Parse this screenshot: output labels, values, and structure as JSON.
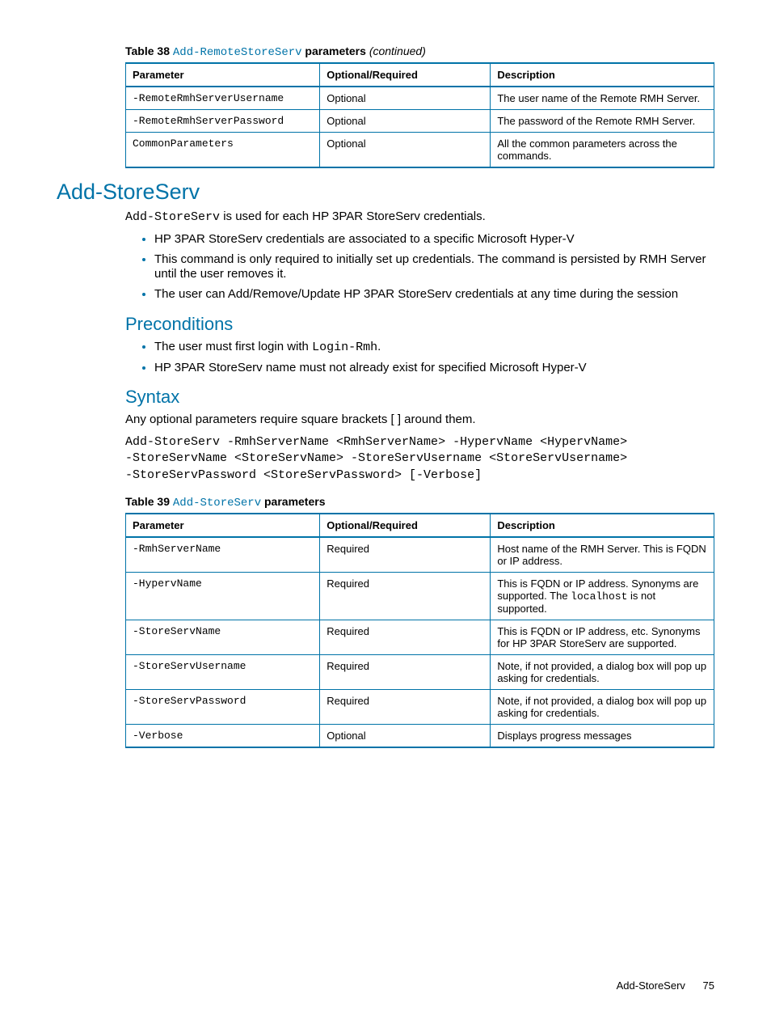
{
  "table38": {
    "caption_prefix": "Table 38 ",
    "caption_code": "Add-RemoteStoreServ",
    "caption_suffix": " parameters ",
    "caption_cont": "(continued)",
    "headers": {
      "param": "Parameter",
      "opt": "Optional/Required",
      "desc": "Description"
    },
    "rows": [
      {
        "param": "-RemoteRmhServerUsername",
        "opt": "Optional",
        "desc": "The user name of the Remote RMH Server."
      },
      {
        "param": "-RemoteRmhServerPassword",
        "opt": "Optional",
        "desc": "The password of the Remote RMH Server."
      },
      {
        "param": "CommonParameters",
        "opt": "Optional",
        "desc": "All the common parameters across the commands."
      }
    ]
  },
  "section": {
    "h1": "Add-StoreServ",
    "intro_code": "Add-StoreServ",
    "intro_rest": " is used for each HP 3PAR StoreServ credentials.",
    "bullets": [
      "HP 3PAR StoreServ credentials are associated to a specific Microsoft Hyper-V",
      "This command is only required to initially set up credentials. The command is persisted by RMH Server until the user removes it.",
      "The user can Add/Remove/Update HP 3PAR StoreServ credentials at any time during the session"
    ]
  },
  "preconditions": {
    "h2": "Preconditions",
    "b1_pre": "The user must first login with ",
    "b1_code": "Login-Rmh",
    "b1_post": ".",
    "b2": "HP 3PAR StoreServ name must not already exist for specified Microsoft Hyper-V"
  },
  "syntax": {
    "h2": "Syntax",
    "note": "Any optional parameters require square brackets [ ] around them.",
    "code": "Add-StoreServ -RmhServerName <RmhServerName> -HypervName <HypervName>\n-StoreServName <StoreServName> -StoreServUsername <StoreServUsername>\n-StoreServPassword <StoreServPassword> [-Verbose]"
  },
  "table39": {
    "caption_prefix": "Table 39 ",
    "caption_code": "Add-StoreServ",
    "caption_suffix": " parameters",
    "headers": {
      "param": "Parameter",
      "opt": "Optional/Required",
      "desc": "Description"
    },
    "rows": [
      {
        "param": "-RmhServerName",
        "opt": "Required",
        "desc_pre": "Host name of the RMH Server. This is FQDN or IP address.",
        "desc_code": "",
        "desc_post": ""
      },
      {
        "param": "-HypervName",
        "opt": "Required",
        "desc_pre": "This is FQDN or IP address. Synonyms are supported. The ",
        "desc_code": "localhost",
        "desc_post": " is not supported."
      },
      {
        "param": "-StoreServName",
        "opt": "Required",
        "desc_pre": "This is FQDN or IP address, etc. Synonyms for HP 3PAR StoreServ are supported.",
        "desc_code": "",
        "desc_post": ""
      },
      {
        "param": "-StoreServUsername",
        "opt": "Required",
        "desc_pre": "Note, if not provided, a dialog box will pop up asking for credentials.",
        "desc_code": "",
        "desc_post": ""
      },
      {
        "param": "-StoreServPassword",
        "opt": "Required",
        "desc_pre": "Note, if not provided, a dialog box will pop up asking for credentials.",
        "desc_code": "",
        "desc_post": ""
      },
      {
        "param": "-Verbose",
        "opt": "Optional",
        "desc_pre": "Displays progress messages",
        "desc_code": "",
        "desc_post": ""
      }
    ]
  },
  "footer": {
    "section": "Add-StoreServ",
    "page": "75"
  }
}
